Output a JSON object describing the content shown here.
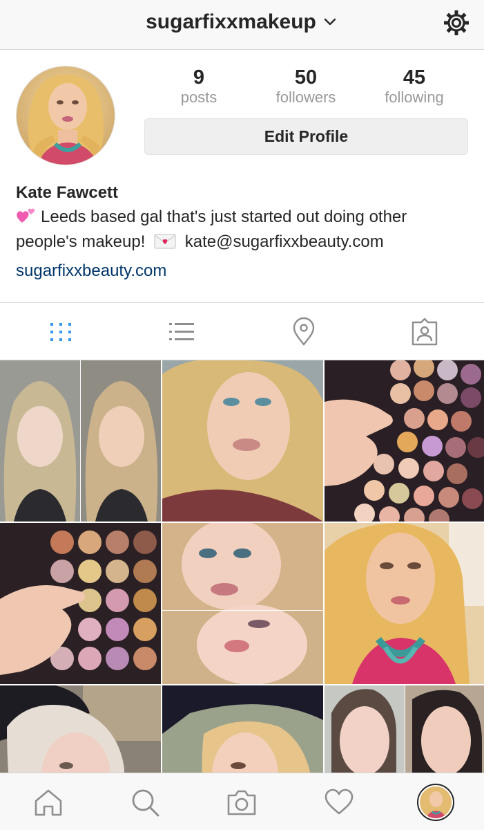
{
  "header": {
    "username": "sugarfixxmakeup",
    "chevron_icon": "chevron-down-icon",
    "settings_icon": "gear-icon"
  },
  "profile": {
    "stats": [
      {
        "value": "9",
        "label": "posts"
      },
      {
        "value": "50",
        "label": "followers"
      },
      {
        "value": "45",
        "label": "following"
      }
    ],
    "edit_label": "Edit Profile",
    "full_name": "Kate Fawcett",
    "bio_line1": "Leeds based gal that's just started out doing other",
    "bio_line2_a": "people's makeup!",
    "bio_line2_b": "kate@sugarfixxbeauty.com",
    "website": "sugarfixxbeauty.com"
  },
  "tabs": [
    {
      "icon": "grid-icon",
      "active": true
    },
    {
      "icon": "list-icon",
      "active": false
    },
    {
      "icon": "location-pin-icon",
      "active": false
    },
    {
      "icon": "tagged-photos-icon",
      "active": false
    }
  ],
  "colors": {
    "accent_active": "#3897f0",
    "link": "#003569",
    "muted": "#999999",
    "text": "#262626"
  },
  "bottom_nav": [
    {
      "icon": "home-icon"
    },
    {
      "icon": "search-icon"
    },
    {
      "icon": "camera-icon"
    },
    {
      "icon": "heart-icon"
    },
    {
      "icon": "profile-avatar-icon"
    }
  ]
}
